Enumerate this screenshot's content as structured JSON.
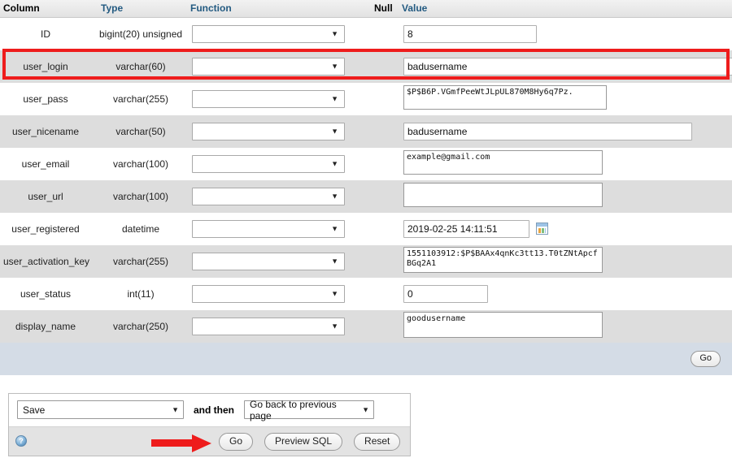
{
  "table": {
    "headers": [
      "Column",
      "Type",
      "Function",
      "Null",
      "Value"
    ],
    "rows": [
      {
        "column": "ID",
        "type": "bigint(20) unsigned",
        "function": "",
        "value": "8"
      },
      {
        "column": "user_login",
        "type": "varchar(60)",
        "function": "",
        "value": "badusername"
      },
      {
        "column": "user_pass",
        "type": "varchar(255)",
        "function": "",
        "value": "$P$B6P.VGmfPeeWtJLpUL870M8Hy6q7Pz."
      },
      {
        "column": "user_nicename",
        "type": "varchar(50)",
        "function": "",
        "value": "badusername"
      },
      {
        "column": "user_email",
        "type": "varchar(100)",
        "function": "",
        "value": "example@gmail.com"
      },
      {
        "column": "user_url",
        "type": "varchar(100)",
        "function": "",
        "value": ""
      },
      {
        "column": "user_registered",
        "type": "datetime",
        "function": "",
        "value": "2019-02-25 14:11:51"
      },
      {
        "column": "user_activation_key",
        "type": "varchar(255)",
        "function": "",
        "value": "1551103912:$P$BAAx4qnKc3tt13.T0tZNtApcfBGq2A1"
      },
      {
        "column": "user_status",
        "type": "int(11)",
        "function": "",
        "value": "0"
      },
      {
        "column": "display_name",
        "type": "varchar(250)",
        "function": "",
        "value": "goodusername"
      }
    ],
    "footer_go_label": "Go"
  },
  "bottom_panel": {
    "action_select_value": "Save",
    "and_then_label": "and then",
    "next_select_value": "Go back to previous page",
    "go_label": "Go",
    "preview_sql_label": "Preview SQL",
    "reset_label": "Reset",
    "help_icon_glyph": "?"
  },
  "annotations": {
    "highlight_color": "#ee1c1c",
    "highlighted_row": "user_login",
    "arrow_points_to": "Go"
  },
  "icons": {
    "calendar": "calendar-icon",
    "dropdown_arrow": "▼"
  }
}
